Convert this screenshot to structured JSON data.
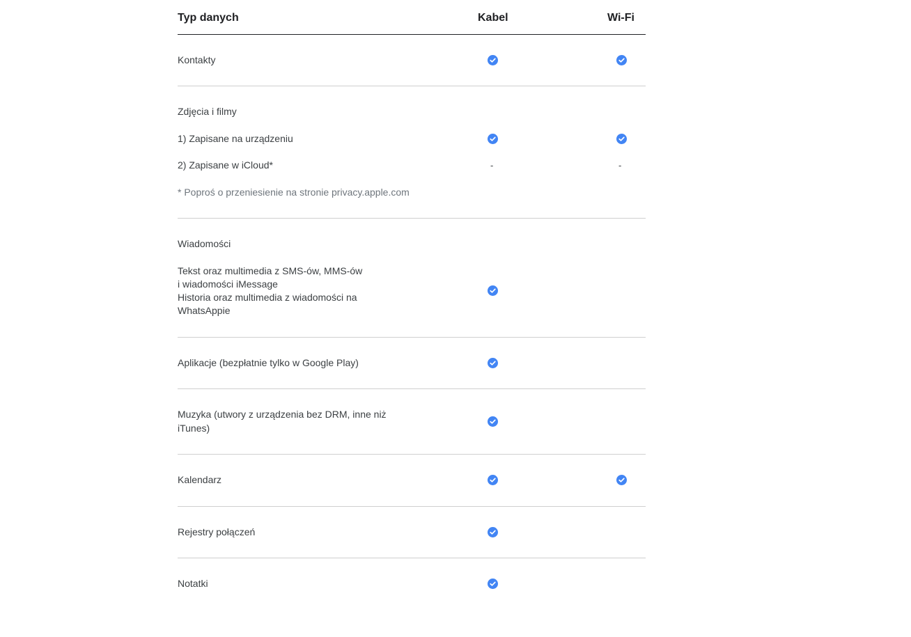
{
  "header": {
    "type": "Typ danych",
    "cable": "Kabel",
    "wifi": "Wi-Fi"
  },
  "rows": {
    "contacts": {
      "label": "Kontakty",
      "cable": true,
      "wifi": true
    },
    "photos": {
      "title": "Zdjęcia i filmy",
      "device": {
        "label": "1) Zapisane na urządzeniu",
        "cable": true,
        "wifi": true
      },
      "icloud": {
        "label": "2) Zapisane w iCloud*",
        "cable": "-",
        "wifi": "-"
      },
      "note": "* Poproś o przeniesienie na stronie privacy.apple.com"
    },
    "messages": {
      "title": "Wiadomości",
      "line1": "Tekst oraz multimedia z SMS-ów, MMS-ów",
      "line2": "i wiadomości iMessage",
      "line3": "Historia oraz multimedia z wiadomości na",
      "line4": "WhatsAppie",
      "cable": true,
      "wifi": false
    },
    "apps": {
      "label": "Aplikacje (bezpłatnie tylko w Google Play)",
      "cable": true,
      "wifi": false
    },
    "music": {
      "line1": "Muzyka (utwory z urządzenia bez DRM, inne niż",
      "line2": "iTunes)",
      "cable": true,
      "wifi": false
    },
    "calendar": {
      "label": "Kalendarz",
      "cable": true,
      "wifi": true
    },
    "calls": {
      "label": "Rejestry połączeń",
      "cable": true,
      "wifi": false
    },
    "notes": {
      "label": "Notatki",
      "cable": true,
      "wifi": false
    }
  },
  "colors": {
    "check": "#4285f4",
    "divider": "#cfcfcf",
    "header_rule": "#202124",
    "note_text": "#6f767d"
  },
  "icons": {
    "check": "check-circle-icon"
  }
}
